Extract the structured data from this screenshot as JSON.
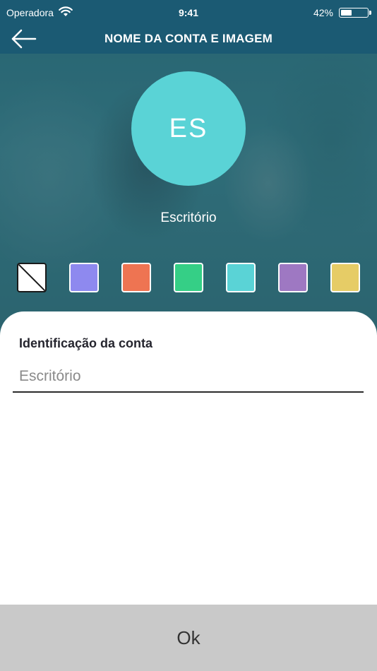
{
  "status_bar": {
    "carrier": "Operadora",
    "time": "9:41",
    "battery_percent": "42%",
    "battery_level": 0.42,
    "wifi_icon": "wifi-icon",
    "battery_icon": "battery-icon"
  },
  "nav": {
    "title": "NOME DA CONTA E IMAGEM",
    "back_icon": "arrow-left-icon"
  },
  "avatar": {
    "initials": "ES",
    "color": "#5ad3d6"
  },
  "account_name": "Escritório",
  "color_swatches": [
    {
      "name": "none",
      "color": "#ffffff"
    },
    {
      "name": "lavender",
      "color": "#8e89ef"
    },
    {
      "name": "orange",
      "color": "#ee7452"
    },
    {
      "name": "green",
      "color": "#35cf86"
    },
    {
      "name": "cyan",
      "color": "#5ad3d6"
    },
    {
      "name": "purple",
      "color": "#9e78c2"
    },
    {
      "name": "yellow",
      "color": "#e6cc66"
    }
  ],
  "form": {
    "label": "Identificação da conta",
    "placeholder": "Escritório"
  },
  "ok_button": "Ok"
}
